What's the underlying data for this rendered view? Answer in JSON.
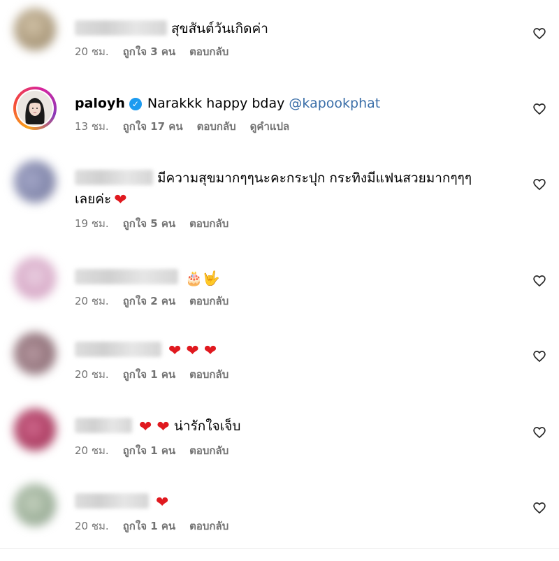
{
  "comments": [
    {
      "text": "สุขสันต์วันเกิดค่า",
      "time": "20 ชม.",
      "likes": "ถูกใจ 3 คน",
      "reply": "ตอบกลับ",
      "avatar_color": "#b9a98f"
    },
    {
      "username": "paloyh",
      "verified": true,
      "text": "Narakkk happy bday",
      "mention": "@kapookphat",
      "time": "13 ชม.",
      "likes": "ถูกใจ 17 คน",
      "reply": "ตอบกลับ",
      "translate": "ดูคำแปล"
    },
    {
      "text": "มีความสุขมากๆๆนะคะกระปุก กระทิงมีแฟนสวยมากๆๆๆ",
      "text_line2": "เลยค่ะ",
      "emoji": "❤",
      "time": "19 ชม.",
      "likes": "ถูกใจ 5 คน",
      "reply": "ตอบกลับ",
      "avatar_color": "#8b8fb0"
    },
    {
      "emoji": "🎂🤟",
      "time": "20 ชม.",
      "likes": "ถูกใจ 2 คน",
      "reply": "ตอบกลับ",
      "avatar_color": "#d8a9c8"
    },
    {
      "emoji": "❤ ❤ ❤",
      "time": "20 ชม.",
      "likes": "ถูกใจ 1 คน",
      "reply": "ตอบกลับ",
      "avatar_color": "#9c7f86"
    },
    {
      "emoji": "❤ ❤",
      "text": "น่ารักใจเจ็บ",
      "time": "20 ชม.",
      "likes": "ถูกใจ 1 คน",
      "reply": "ตอบกลับ",
      "avatar_color": "#b8476e"
    },
    {
      "emoji": "❤",
      "time": "20 ชม.",
      "likes": "ถูกใจ 1 คน",
      "reply": "ตอบกลับ",
      "avatar_color": "#9fb29a"
    }
  ],
  "colors": {
    "heart": "#e0191f",
    "mention": "#3a6ea8",
    "meta": "#737373",
    "verified": "#1d9bf0"
  }
}
